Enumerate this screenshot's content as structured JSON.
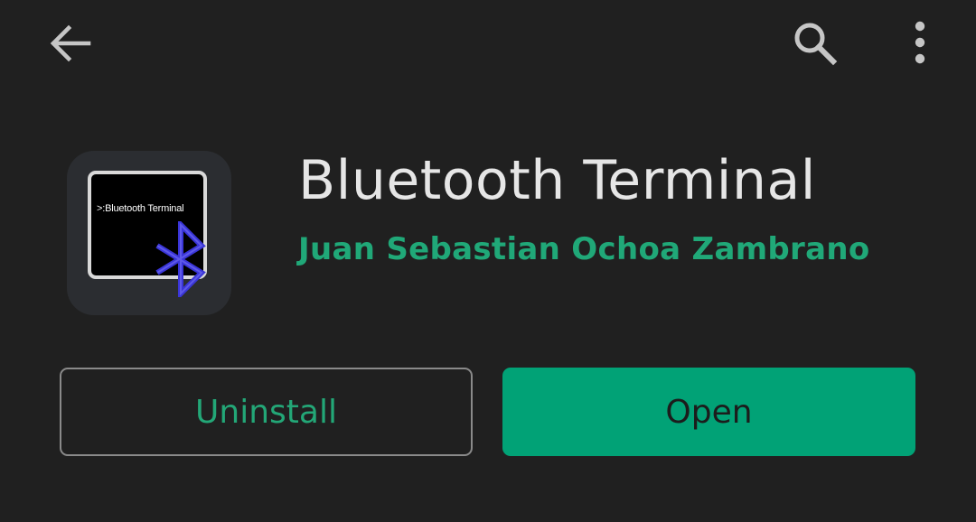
{
  "toolbar": {
    "back_icon": "arrow-back-icon",
    "search_icon": "search-icon",
    "more_icon": "more-vert-icon"
  },
  "app": {
    "icon_screen_text": ">:Bluetooth Terminal",
    "title": "Bluetooth Terminal",
    "developer": "Juan Sebastian Ochoa Zambrano"
  },
  "actions": {
    "uninstall_label": "Uninstall",
    "open_label": "Open"
  },
  "colors": {
    "background": "#202020",
    "accent": "#01a276",
    "title_text": "#e6e6e6",
    "developer_text": "#20a878",
    "bluetooth_symbol": "#3a35d8"
  }
}
